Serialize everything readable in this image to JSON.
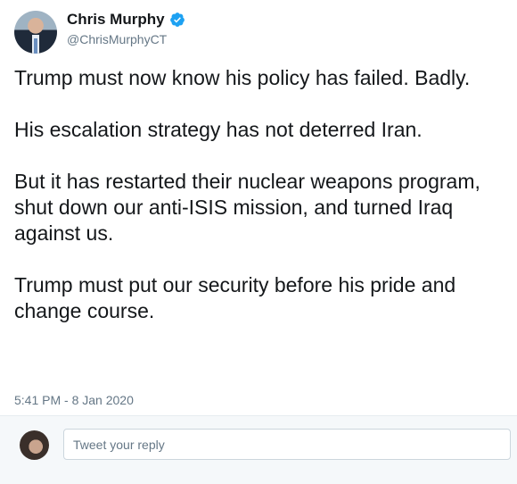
{
  "author": {
    "display_name": "Chris Murphy",
    "handle": "@ChrisMurphyCT",
    "verified": true,
    "verified_icon": "verified-badge-icon",
    "accent_color": "#1da1f2"
  },
  "tweet": {
    "paragraphs": [
      "Trump must now know his policy has failed. Badly.",
      "His escalation strategy has not deterred Iran.",
      "But it has restarted their nuclear weapons program, shut down our anti-ISIS mission, and turned Iraq against us.",
      "Trump must put our security before his pride and change course."
    ],
    "timestamp": "5:41 PM - 8 Jan 2020"
  },
  "reply": {
    "placeholder": "Tweet your reply"
  }
}
